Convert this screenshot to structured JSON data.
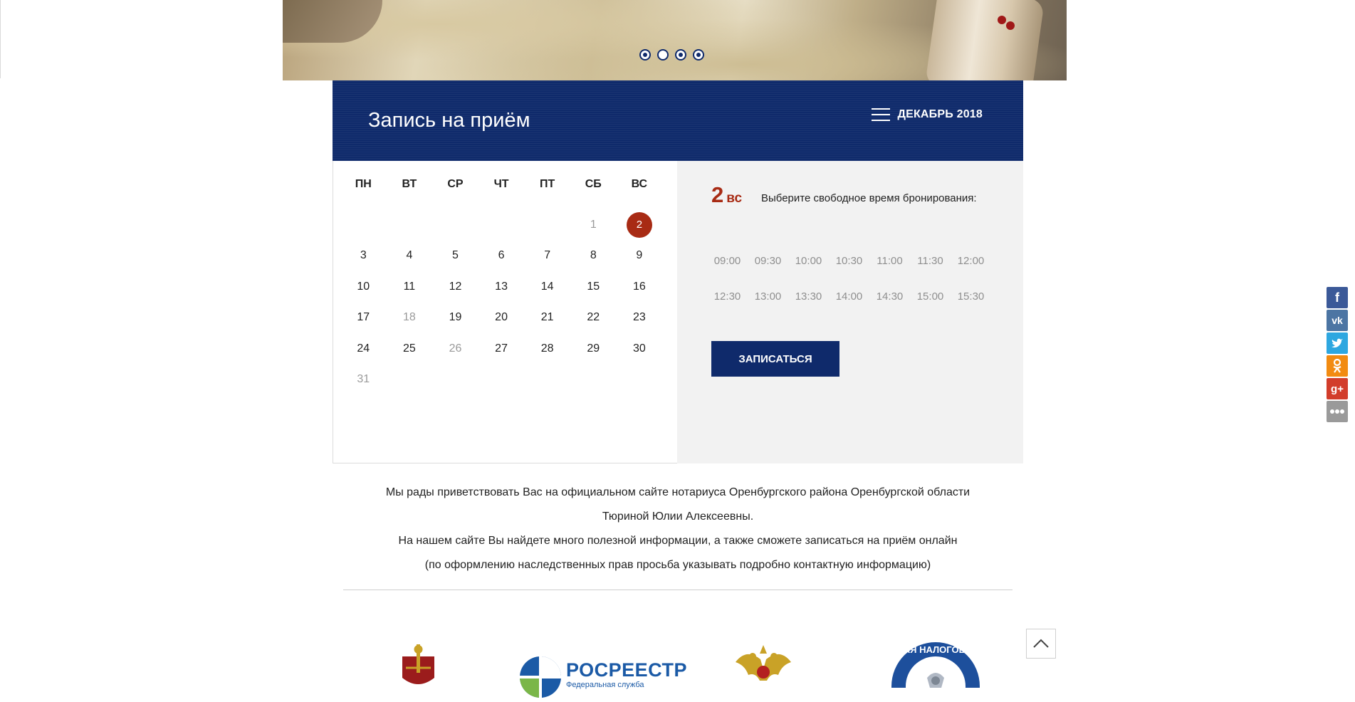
{
  "slider": {
    "dots": 4,
    "active_dots": [
      1,
      3,
      4
    ]
  },
  "booking": {
    "title": "Запись на приём",
    "month_label": "ДЕКАБРЬ 2018",
    "weekdays": [
      "ПН",
      "ВТ",
      "СР",
      "ЧТ",
      "ПТ",
      "СБ",
      "ВС"
    ],
    "weeks": [
      [
        "",
        "",
        "",
        "",
        "",
        "1",
        "2"
      ],
      [
        "3",
        "4",
        "5",
        "6",
        "7",
        "8",
        "9"
      ],
      [
        "10",
        "11",
        "12",
        "13",
        "14",
        "15",
        "16"
      ],
      [
        "17",
        "18",
        "19",
        "20",
        "21",
        "22",
        "23"
      ],
      [
        "24",
        "25",
        "26",
        "27",
        "28",
        "29",
        "30"
      ],
      [
        "31",
        "",
        "",
        "",
        "",
        "",
        ""
      ]
    ],
    "muted_days": [
      "1",
      "18",
      "26",
      "31"
    ],
    "selected_day": "2",
    "selected_day_num": "2",
    "selected_day_dow": "вс",
    "pick_time_text": "Выберите свободное время бронирования:",
    "time_slots": [
      [
        "09:00",
        "09:30",
        "10:00",
        "10:30",
        "11:00",
        "11:30",
        "12:00"
      ],
      [
        "12:30",
        "13:00",
        "13:30",
        "14:00",
        "14:30",
        "15:00",
        "15:30"
      ]
    ],
    "book_button": "ЗАПИСАТЬСЯ"
  },
  "welcome": {
    "line1": "Мы рады приветствовать Вас на официальном сайте нотариуса Оренбургского района Оренбургской области",
    "line2": "Тюриной Юлии Алексеевны.",
    "line3": "На нашем сайте Вы найдете много полезной информации, а также сможете записаться на приём онлайн",
    "line4": "(по оформлению наследственных прав просьба указывать подробно контактную информацию)"
  },
  "partners": {
    "rosreestr_title": "РОСРЕЕСТР",
    "rosreestr_sub": "Федеральная служба",
    "fns_text": "ЛЬНАЯ НАЛОГОВАЯ С"
  },
  "social": [
    "facebook-icon",
    "vk-icon",
    "twitter-icon",
    "odnoklassniki-icon",
    "google-plus-icon",
    "more-icon"
  ],
  "colors": {
    "brand_blue": "#0f2a6b",
    "selected_red": "#a82b14",
    "panel_gray": "#f2f2f2"
  }
}
